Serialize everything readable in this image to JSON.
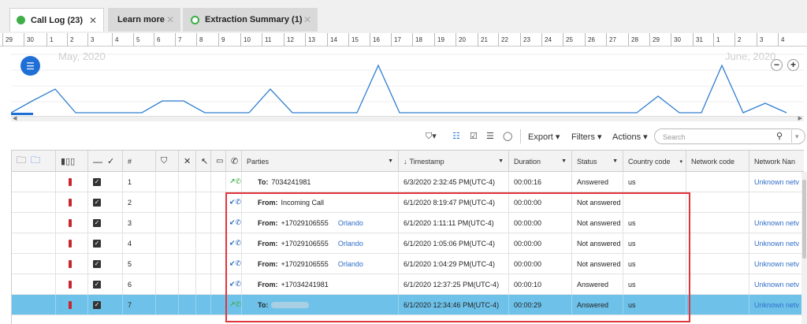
{
  "tabs": [
    {
      "label": "Call Log (23)",
      "state": "active",
      "icon": "green-dot-icon",
      "close": "✕"
    },
    {
      "label": "Learn more",
      "state": "inactive",
      "close": "✕"
    },
    {
      "label": "Extraction Summary (1)",
      "state": "inactive",
      "icon": "green-ring-icon",
      "close": "✕"
    }
  ],
  "ruler": {
    "days": [
      "29",
      "30",
      "1",
      "2",
      "3",
      "4",
      "5",
      "6",
      "7",
      "8",
      "9",
      "10",
      "11",
      "12",
      "13",
      "14",
      "15",
      "16",
      "17",
      "18",
      "19",
      "20",
      "21",
      "22",
      "23",
      "24",
      "25",
      "26",
      "27",
      "28",
      "29",
      "30",
      "31",
      "1",
      "2",
      "3",
      "4"
    ]
  },
  "timeline": {
    "month_left": "May, 2020",
    "month_right": "June, 2020",
    "zoom_out": "−",
    "zoom_in": "+",
    "series": [
      0,
      0.5,
      1,
      0,
      0,
      0,
      0,
      0.5,
      0.5,
      0,
      0,
      0,
      1,
      0,
      0,
      0,
      0,
      2,
      0,
      0,
      0,
      0,
      0,
      0,
      0,
      0,
      0,
      0,
      0,
      0,
      0.7,
      0,
      0,
      2,
      0,
      0.4,
      0
    ]
  },
  "toolbar": {
    "export": "Export",
    "filters": "Filters",
    "actions": "Actions",
    "search_placeholder": "Search"
  },
  "columns": {
    "num": "#",
    "parties": "Parties",
    "timestamp": "Timestamp",
    "duration": "Duration",
    "status": "Status",
    "country_code": "Country code",
    "network_code": "Network code",
    "network_name": "Network Nan"
  },
  "rows": [
    {
      "num": "1",
      "dir": "out",
      "party_prefix": "To:",
      "party": "7034241981",
      "location": "",
      "timestamp": "6/3/2020 2:32:45 PM(UTC-4)",
      "duration": "00:00:16",
      "status": "Answered",
      "country": "us",
      "network_name": "Unknown netv"
    },
    {
      "num": "2",
      "dir": "in",
      "party_prefix": "From:",
      "party": "Incoming Call",
      "location": "",
      "timestamp": "6/1/2020 8:19:47 PM(UTC-4)",
      "duration": "00:00:00",
      "status": "Not answered",
      "country": "",
      "network_name": ""
    },
    {
      "num": "3",
      "dir": "in",
      "party_prefix": "From:",
      "party": "+17029106555",
      "location": "Orlando",
      "timestamp": "6/1/2020 1:11:11 PM(UTC-4)",
      "duration": "00:00:00",
      "status": "Not answered",
      "country": "us",
      "network_name": "Unknown netv"
    },
    {
      "num": "4",
      "dir": "in",
      "party_prefix": "From:",
      "party": "+17029106555",
      "location": "Orlando",
      "timestamp": "6/1/2020 1:05:06 PM(UTC-4)",
      "duration": "00:00:00",
      "status": "Not answered",
      "country": "us",
      "network_name": "Unknown netv"
    },
    {
      "num": "5",
      "dir": "in",
      "party_prefix": "From:",
      "party": "+17029106555",
      "location": "Orlando",
      "timestamp": "6/1/2020 1:04:29 PM(UTC-4)",
      "duration": "00:00:00",
      "status": "Not answered",
      "country": "us",
      "network_name": "Unknown netv"
    },
    {
      "num": "6",
      "dir": "in",
      "party_prefix": "From:",
      "party": "+17034241981",
      "location": "",
      "timestamp": "6/1/2020 12:37:25 PM(UTC-4)",
      "duration": "00:00:10",
      "status": "Answered",
      "country": "us",
      "network_name": "Unknown netv"
    },
    {
      "num": "7",
      "dir": "out",
      "party_prefix": "To:",
      "party": "",
      "location": "",
      "timestamp": "6/1/2020 12:34:46 PM(UTC-4)",
      "duration": "00:00:29",
      "status": "Answered",
      "country": "us",
      "network_name": "Unknown netv",
      "selected": true
    }
  ],
  "colors": {
    "accent": "#1f6fd6",
    "selected_row": "#6ec2ea",
    "highlight_box": "#e0353c",
    "flag": "#c8262f",
    "outgoing": "#3fae49",
    "incoming": "#1e5fb8"
  }
}
